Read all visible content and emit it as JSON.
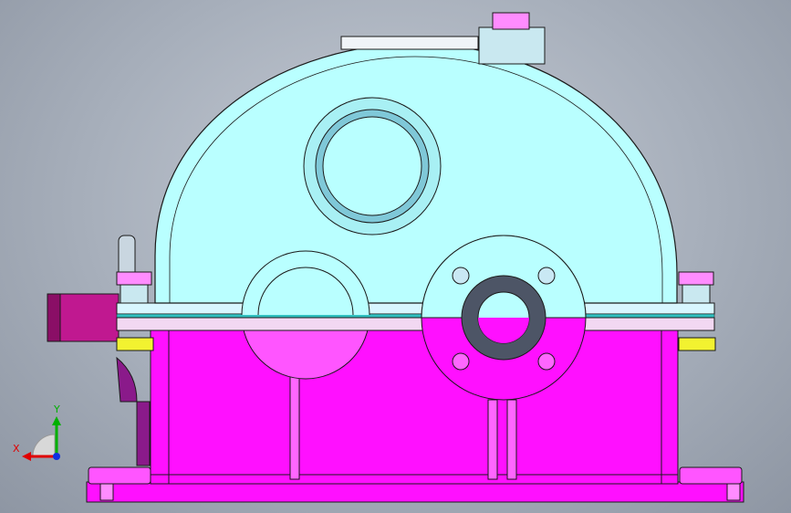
{
  "viewport": {
    "background": "#a7afbb",
    "model": {
      "name": "gearbox",
      "colors": {
        "upper_casing": "#b9ffff",
        "lower_casing": "#ff10ff",
        "bolts": "#ff8cff",
        "nuts": "#f2f230",
        "edge": "#1a1a1a",
        "seal_ring": "#4d5566"
      }
    },
    "triad": {
      "x_label": "X",
      "y_label": "Y",
      "x_color": "#e00000",
      "y_color": "#00b000",
      "z_color": "#1030e0"
    }
  }
}
